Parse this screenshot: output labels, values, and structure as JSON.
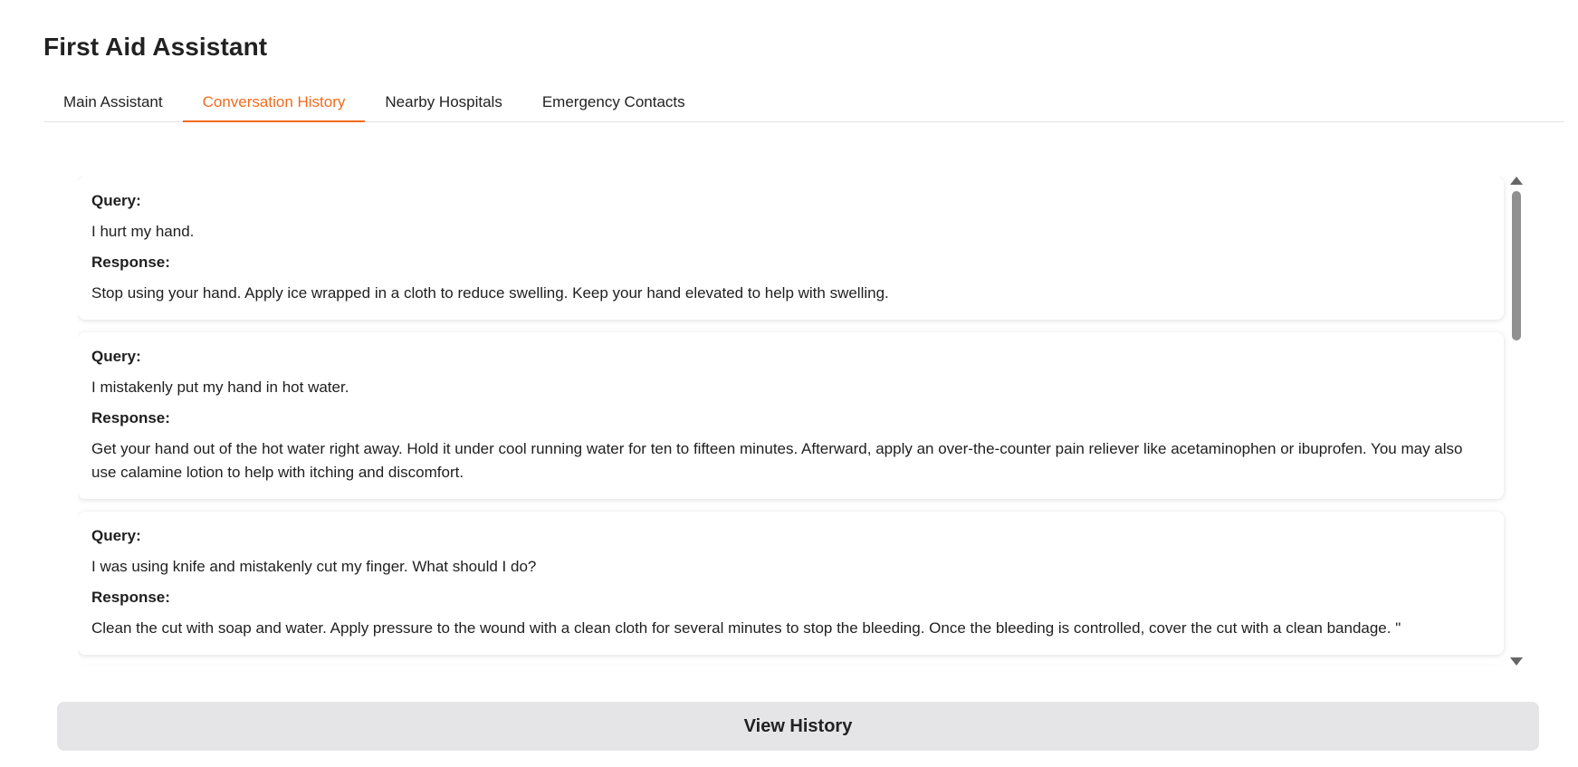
{
  "app": {
    "title": "First Aid Assistant"
  },
  "tabs": [
    {
      "label": "Main Assistant",
      "active": false
    },
    {
      "label": "Conversation History",
      "active": true
    },
    {
      "label": "Nearby Hospitals",
      "active": false
    },
    {
      "label": "Emergency Contacts",
      "active": false
    }
  ],
  "history": {
    "query_label": "Query:",
    "response_label": "Response:",
    "entries": [
      {
        "query": "I hurt my hand.",
        "response": "Stop using your hand. Apply ice wrapped in a cloth to reduce swelling. Keep your hand elevated to help with swelling."
      },
      {
        "query": "I mistakenly put my hand in hot water.",
        "response": "Get your hand out of the hot water right away. Hold it under cool running water for ten to fifteen minutes. Afterward, apply an over-the-counter pain reliever like acetaminophen or ibuprofen. You may also use calamine lotion to help with itching and discomfort."
      },
      {
        "query": "I was using knife and mistakenly cut my finger. What should I do?",
        "response": "Clean the cut with soap and water. Apply pressure to the wound with a clean cloth for several minutes to stop the bleeding. Once the bleeding is controlled, cover the cut with a clean bandage. \""
      }
    ]
  },
  "actions": {
    "view_history_label": "View History"
  },
  "colors": {
    "accent": "#f26b1d",
    "button_bg": "#e5e5e7"
  }
}
